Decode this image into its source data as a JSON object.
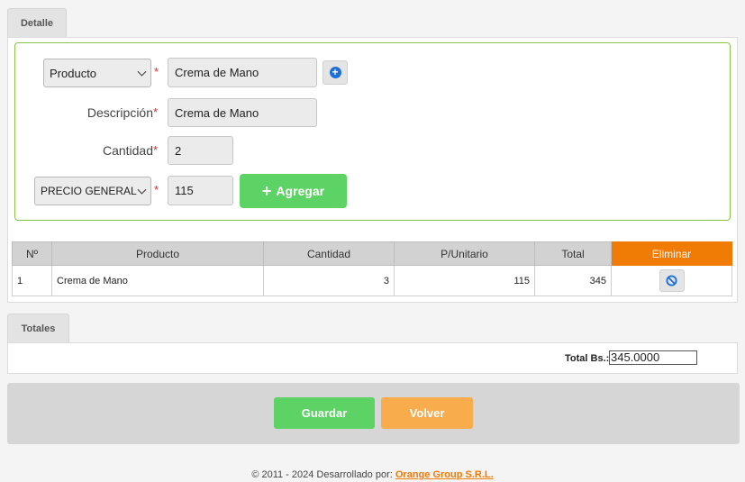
{
  "tabs": {
    "detalle": "Detalle",
    "totales": "Totales"
  },
  "form": {
    "product_select": "Producto",
    "product_value": "Crema de Mano",
    "description_label": "Descripción",
    "description_value": "Crema de Mano",
    "quantity_label": "Cantidad",
    "quantity_value": "2",
    "price_select": "PRECIO GENERAL",
    "price_value": "115",
    "required_mark": "*",
    "add_button": "Agregar",
    "add_button_icon": "+"
  },
  "table": {
    "headers": [
      "Nº",
      "Producto",
      "Cantidad",
      "P/Unitario",
      "Total",
      "Eliminar"
    ],
    "rows": [
      {
        "n": "1",
        "producto": "Crema de Mano",
        "cantidad": "3",
        "p_unitario": "115",
        "total": "345"
      }
    ]
  },
  "totals": {
    "label": "Total Bs.:",
    "value": "345.0000"
  },
  "actions": {
    "save": "Guardar",
    "back": "Volver"
  },
  "footer": {
    "text": "© 2011 - 2024 Desarrollado por:",
    "company": "Orange Group S.R.L."
  },
  "colors": {
    "green": "#5cd364",
    "orange": "#f07b05",
    "light_orange": "#f9ac4b",
    "blue": "#1e6fd9",
    "border_green": "#8bc34a"
  }
}
